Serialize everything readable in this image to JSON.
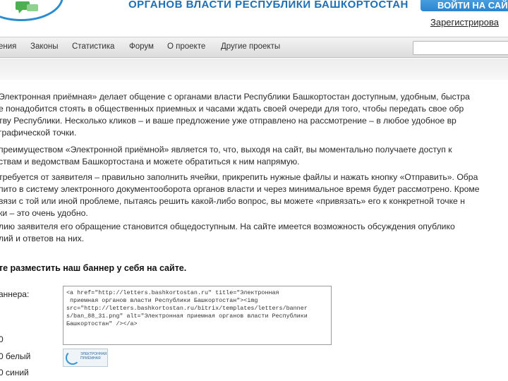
{
  "header": {
    "site_title": "ОРГАНОВ ВЛАСТИ РЕСПУБЛИКИ БАШКОРТОСТАН",
    "login_label": "ВОЙТИ НА САЙ",
    "register_label": "Зарегистрирова",
    "colors": {
      "brand_blue": "#1f6fb3",
      "accent_green": "#4caf50"
    }
  },
  "nav": {
    "items": [
      "ения",
      "Законы",
      "Статистика",
      "Форум",
      "О проекте",
      "Другие проекты"
    ],
    "search_value": ""
  },
  "content": {
    "paragraphs": [
      [
        "Электронная приёмная» делает общение с органами власти Республики Башкортостан доступным, удобным, быстра",
        "е понадобится стоять в общественных приемных и часами ждать своей очереди для того, чтобы передать свое обр",
        "тву Республики. Несколько кликов – и ваше предложение уже отправлено на рассмотрение – в любое удобное вр",
        "графической точки."
      ],
      [
        "преимуществом «Электронной приёмной» является то, что, выходя на сайт, вы моментально получаете доступ к",
        "ствам и ведомствам Башкортостана и можете обратиться к ним напрямую."
      ],
      [
        "требуется от заявителя – правильно заполнить ячейки, прикрепить нужные файлы и нажать кнопку «Отправить». Обра",
        "пито в систему электронного документооборота органов власти и через минимальное время будет рассмотрено. Кроме",
        "вязи с той или иной проблеме, пытаясь решить какой-либо вопрос, вы можете «привязать» его к конкретной точке н",
        "ки – это очень удобно."
      ],
      [
        "лию заявителя его обращение становится общедоступным. На сайте имеется возможность обсуждения опублико",
        "лий и ответов на них."
      ]
    ],
    "banner_heading": "те разместить наш баннер у себя на сайте.",
    "code_label": "аннера:",
    "size_label": "0",
    "white_label": "0 белый",
    "blue_label": "0 синий",
    "code_text": "<a href=\"http://letters.bashkortostan.ru\" title=\"Электронная\n приемная органов власти Республики Башкортостан\"><img\nsrc=\"http://letters.bashkortostan.ru/bitrix/templates/letters/banner\ns/ban_88_31.png\" alt=\"Электронная приемная органов власти Республики\nБашкортостан\" /></a>",
    "thumb_text": "ЭЛЕКТРОННАЯ\nПРИЁМНАЯ"
  }
}
